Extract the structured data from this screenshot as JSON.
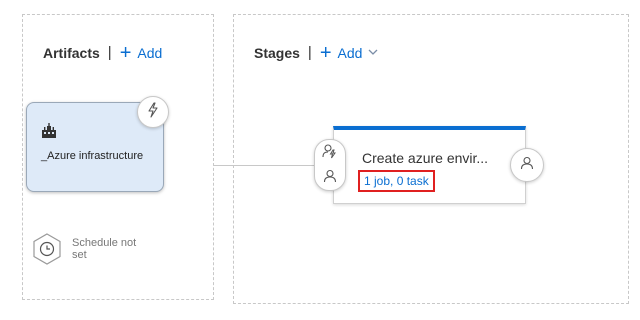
{
  "artifacts": {
    "title": "Artifacts",
    "add_label": "Add",
    "card": {
      "name": "_Azure infrastructure"
    },
    "schedule": {
      "label": "Schedule not set"
    }
  },
  "stages": {
    "title": "Stages",
    "add_label": "Add",
    "stage": {
      "name": "Create azure envir...",
      "tasks_link": "1 job, 0 task"
    }
  },
  "colors": {
    "accent": "#0a6ed1",
    "highlight": "#e02020",
    "card_bg": "#deeaf8"
  },
  "icons": {
    "trigger": "lightning-icon",
    "build": "build-pipeline-icon",
    "schedule": "clock-icon",
    "pre_deployment": "lightning-person-icon",
    "pre_approvals": "person-icon",
    "post_approvals": "person-icon"
  }
}
